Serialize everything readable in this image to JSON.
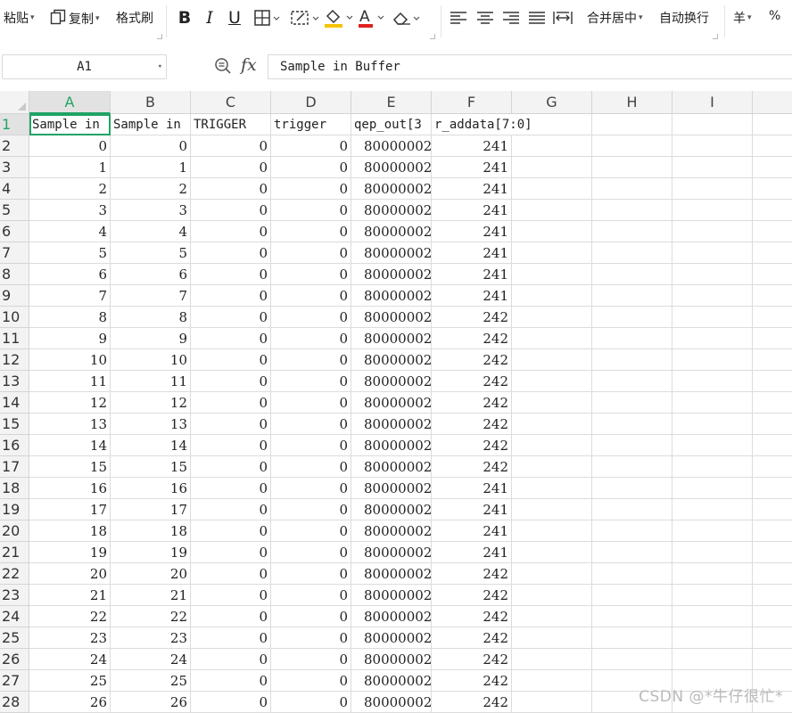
{
  "toolbar": {
    "paste_label": "粘贴",
    "copy_label": "复制",
    "format_painter_label": "格式刷",
    "merge_center_label": "合并居中",
    "wrap_text_label": "自动换行",
    "currency_label": "羊",
    "percent_label": "%",
    "font_color": "#e02020",
    "highlight_color": "#f5c400"
  },
  "formula_bar": {
    "cell_ref": "A1",
    "fx_label": "fx",
    "content": "Sample in Buffer"
  },
  "grid": {
    "columns": [
      "A",
      "B",
      "C",
      "D",
      "E",
      "F",
      "G",
      "H",
      "I"
    ],
    "active_column": "A",
    "active_row": "1",
    "header_row": [
      "Sample in",
      "Sample in",
      "TRIGGER",
      "trigger",
      "qep_out[3",
      "r_addata[7:0]"
    ],
    "rows": [
      {
        "n": "2",
        "a": "0",
        "b": "0",
        "c": "0",
        "d": "0",
        "e": "80000002",
        "f": "241"
      },
      {
        "n": "3",
        "a": "1",
        "b": "1",
        "c": "0",
        "d": "0",
        "e": "80000002",
        "f": "241"
      },
      {
        "n": "4",
        "a": "2",
        "b": "2",
        "c": "0",
        "d": "0",
        "e": "80000002",
        "f": "241"
      },
      {
        "n": "5",
        "a": "3",
        "b": "3",
        "c": "0",
        "d": "0",
        "e": "80000002",
        "f": "241"
      },
      {
        "n": "6",
        "a": "4",
        "b": "4",
        "c": "0",
        "d": "0",
        "e": "80000002",
        "f": "241"
      },
      {
        "n": "7",
        "a": "5",
        "b": "5",
        "c": "0",
        "d": "0",
        "e": "80000002",
        "f": "241"
      },
      {
        "n": "8",
        "a": "6",
        "b": "6",
        "c": "0",
        "d": "0",
        "e": "80000002",
        "f": "241"
      },
      {
        "n": "9",
        "a": "7",
        "b": "7",
        "c": "0",
        "d": "0",
        "e": "80000002",
        "f": "241"
      },
      {
        "n": "10",
        "a": "8",
        "b": "8",
        "c": "0",
        "d": "0",
        "e": "80000002",
        "f": "242"
      },
      {
        "n": "11",
        "a": "9",
        "b": "9",
        "c": "0",
        "d": "0",
        "e": "80000002",
        "f": "242"
      },
      {
        "n": "12",
        "a": "10",
        "b": "10",
        "c": "0",
        "d": "0",
        "e": "80000002",
        "f": "242"
      },
      {
        "n": "13",
        "a": "11",
        "b": "11",
        "c": "0",
        "d": "0",
        "e": "80000002",
        "f": "242"
      },
      {
        "n": "14",
        "a": "12",
        "b": "12",
        "c": "0",
        "d": "0",
        "e": "80000002",
        "f": "242"
      },
      {
        "n": "15",
        "a": "13",
        "b": "13",
        "c": "0",
        "d": "0",
        "e": "80000002",
        "f": "242"
      },
      {
        "n": "16",
        "a": "14",
        "b": "14",
        "c": "0",
        "d": "0",
        "e": "80000002",
        "f": "242"
      },
      {
        "n": "17",
        "a": "15",
        "b": "15",
        "c": "0",
        "d": "0",
        "e": "80000002",
        "f": "242"
      },
      {
        "n": "18",
        "a": "16",
        "b": "16",
        "c": "0",
        "d": "0",
        "e": "80000002",
        "f": "241"
      },
      {
        "n": "19",
        "a": "17",
        "b": "17",
        "c": "0",
        "d": "0",
        "e": "80000002",
        "f": "241"
      },
      {
        "n": "20",
        "a": "18",
        "b": "18",
        "c": "0",
        "d": "0",
        "e": "80000002",
        "f": "241"
      },
      {
        "n": "21",
        "a": "19",
        "b": "19",
        "c": "0",
        "d": "0",
        "e": "80000002",
        "f": "241"
      },
      {
        "n": "22",
        "a": "20",
        "b": "20",
        "c": "0",
        "d": "0",
        "e": "80000002",
        "f": "242"
      },
      {
        "n": "23",
        "a": "21",
        "b": "21",
        "c": "0",
        "d": "0",
        "e": "80000002",
        "f": "242"
      },
      {
        "n": "24",
        "a": "22",
        "b": "22",
        "c": "0",
        "d": "0",
        "e": "80000002",
        "f": "242"
      },
      {
        "n": "25",
        "a": "23",
        "b": "23",
        "c": "0",
        "d": "0",
        "e": "80000002",
        "f": "242"
      },
      {
        "n": "26",
        "a": "24",
        "b": "24",
        "c": "0",
        "d": "0",
        "e": "80000002",
        "f": "242"
      },
      {
        "n": "27",
        "a": "25",
        "b": "25",
        "c": "0",
        "d": "0",
        "e": "80000002",
        "f": "242"
      },
      {
        "n": "28",
        "a": "26",
        "b": "26",
        "c": "0",
        "d": "0",
        "e": "80000002",
        "f": "242"
      }
    ]
  },
  "watermark": "CSDN @*牛仔很忙*",
  "accent_color": "#21a366"
}
